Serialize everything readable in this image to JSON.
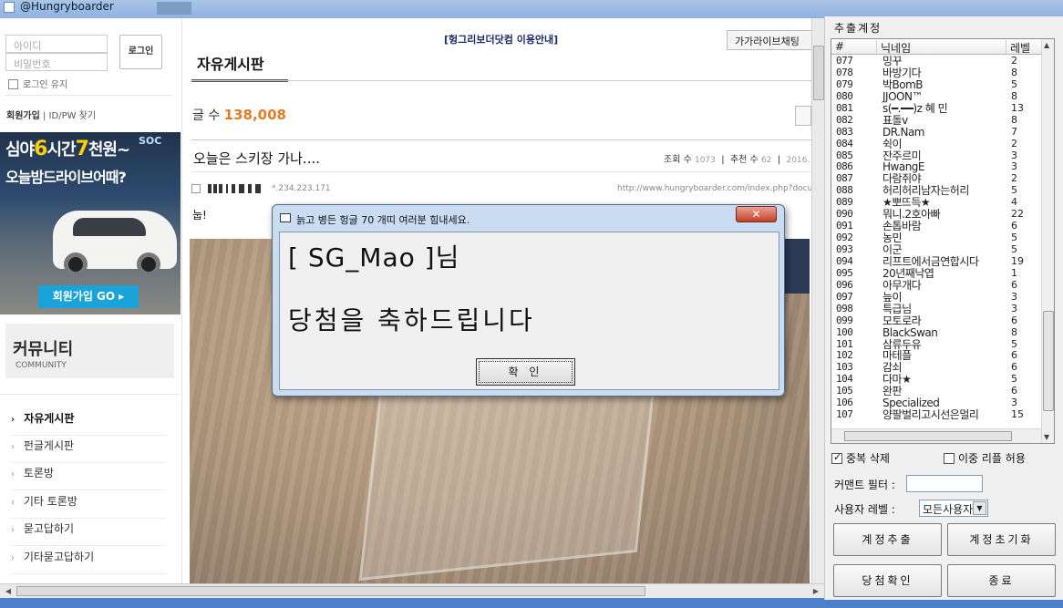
{
  "window": {
    "title": "@Hungryboarder"
  },
  "login": {
    "id_placeholder": "아이디",
    "pw_placeholder": "비밀번호",
    "button": "로그인",
    "keep": "로그인 유지",
    "join": "회원가입",
    "find": "ID/PW 찾기"
  },
  "ad": {
    "line1_a": "심야",
    "line1_b": "6",
    "line1_c": "시간",
    "line1_d": "7",
    "line1_e": "천원~",
    "line2": "오늘밤드라이브어때?",
    "soc": "SOC",
    "cta": "회원가입 GO ▸"
  },
  "community": {
    "title": "커뮤니티",
    "subtitle": "COMMUNITY"
  },
  "menu": [
    {
      "label": "자유게시판",
      "active": true
    },
    {
      "label": "펀글게시판"
    },
    {
      "label": "토론방"
    },
    {
      "label": "기타 토론방"
    },
    {
      "label": "묻고답하기"
    },
    {
      "label": "기타묻고답하기"
    }
  ],
  "main": {
    "notice": "[헝그리보더닷컴 이용안내]",
    "side_button": "가가라이브채팅",
    "board_title": "자유게시판",
    "count_label": "글 수",
    "count_value": "138,008",
    "post_title": "오늘은 스키장 가나....",
    "views_label": "조회 수",
    "views": "1073",
    "recommend_label": "추천 수",
    "recommend": "62",
    "date": "2016.",
    "ip": "*.234.223.171",
    "url": "http://www.hungryboarder.com/index.php?document",
    "body": "눕!"
  },
  "dialog": {
    "title": "늙고 병든 헝글 70 개띠 여러분 힘내세요.",
    "line1": "[ SG_Mao ]님",
    "line2": "당첨을 축하드립니다",
    "ok": "확 인",
    "close": "✕"
  },
  "panel": {
    "title": "추출계정",
    "headers": {
      "no": "#",
      "nick": "닉네임",
      "level": "레벨"
    },
    "rows": [
      {
        "no": "077",
        "nick": "밍꾸",
        "level": "2"
      },
      {
        "no": "078",
        "nick": "바방기다",
        "level": "8"
      },
      {
        "no": "079",
        "nick": "박BomB",
        "level": "5"
      },
      {
        "no": "080",
        "nick": "JJOON™",
        "level": "8"
      },
      {
        "no": "081",
        "nick": "s(━.━━)z  혜  민",
        "level": "13"
      },
      {
        "no": "082",
        "nick": "표돌v",
        "level": "8"
      },
      {
        "no": "083",
        "nick": "DR.Nam",
        "level": "7"
      },
      {
        "no": "084",
        "nick": "쉭이",
        "level": "2"
      },
      {
        "no": "085",
        "nick": "잔주르미",
        "level": "3"
      },
      {
        "no": "086",
        "nick": "HwangE",
        "level": "3"
      },
      {
        "no": "087",
        "nick": "다람쥐야",
        "level": "2"
      },
      {
        "no": "088",
        "nick": "허리허리남자는허리",
        "level": "5"
      },
      {
        "no": "089",
        "nick": "★뽀뜨득★",
        "level": "4"
      },
      {
        "no": "090",
        "nick": "뭐니.2호아빠",
        "level": "22"
      },
      {
        "no": "091",
        "nick": "손톱바람",
        "level": "6"
      },
      {
        "no": "092",
        "nick": "농민",
        "level": "5"
      },
      {
        "no": "093",
        "nick": "이군",
        "level": "5"
      },
      {
        "no": "094",
        "nick": "리프트에서금연합시다",
        "level": "19"
      },
      {
        "no": "095",
        "nick": "20년째낙엽",
        "level": "1"
      },
      {
        "no": "096",
        "nick": "아무개다",
        "level": "6"
      },
      {
        "no": "097",
        "nick": "늪이",
        "level": "3"
      },
      {
        "no": "098",
        "nick": "특급님",
        "level": "3"
      },
      {
        "no": "099",
        "nick": "모토로라",
        "level": "6"
      },
      {
        "no": "100",
        "nick": "BlackSwan",
        "level": "8"
      },
      {
        "no": "101",
        "nick": "삼류두유",
        "level": "5"
      },
      {
        "no": "102",
        "nick": "마테플",
        "level": "6"
      },
      {
        "no": "103",
        "nick": "감쇠",
        "level": "6"
      },
      {
        "no": "104",
        "nick": "다마★",
        "level": "5"
      },
      {
        "no": "105",
        "nick": "완판",
        "level": "6"
      },
      {
        "no": "106",
        "nick": "Specialized",
        "level": "3"
      },
      {
        "no": "107",
        "nick": "양팔벌리고시선은멀리",
        "level": "15"
      }
    ],
    "dedupe": "중복 삭제",
    "dedupe_checked": true,
    "double_reply": "이중 리플 허용",
    "double_reply_checked": false,
    "filter_label": "커맨트 필터 :",
    "filter_value": "",
    "level_label": "사용자 레벨 :",
    "level_value": "모든사용자",
    "btn_extract": "계정추출",
    "btn_reset": "계정초기화",
    "btn_check": "당첨확인",
    "btn_exit": "종료"
  },
  "colors": {
    "accent_orange": "#e57b23",
    "window_blue": "#4d80c8"
  }
}
